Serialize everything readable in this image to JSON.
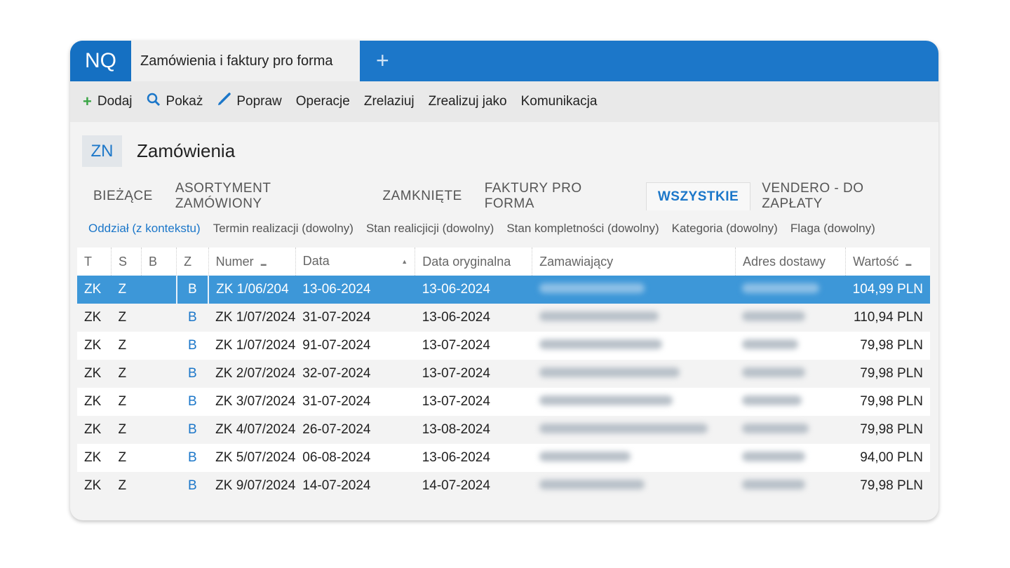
{
  "app": {
    "logo": "NQ",
    "tab_title": "Zamówienia i faktury pro forma",
    "new_tab": "+"
  },
  "toolbar": [
    {
      "label": "Dodaj",
      "icon": "plus-icon"
    },
    {
      "label": "Pokaż",
      "icon": "search-icon"
    },
    {
      "label": "Popraw",
      "icon": "brush-icon"
    },
    {
      "label": "Operacje"
    },
    {
      "label": "Zrelaziuj"
    },
    {
      "label": "Zrealizuj jako"
    },
    {
      "label": "Komunikacja"
    }
  ],
  "header": {
    "badge": "ZN",
    "title": "Zamówienia"
  },
  "tabs": [
    "BIEŻĄCE",
    "ASORTYMENT ZAMÓWIONY",
    "ZAMKNIĘTE",
    "FAKTURY PRO FORMA",
    "WSZYSTKIE",
    "VENDERO - DO ZAPŁATY"
  ],
  "active_tab": "WSZYSTKIE",
  "filters": [
    "Oddział (z kontekstu)",
    "Termin realizacji (dowolny)",
    "Stan realicjicji (dowolny)",
    "Stan kompletności (dowolny)",
    "Kategoria (dowolny)",
    "Flaga (dowolny)"
  ],
  "columns": [
    "T",
    "S",
    "B",
    "Z",
    "Numer",
    "Data",
    "Data oryginalna",
    "Zamawiający",
    "Adres dostawy",
    "Wartość"
  ],
  "rows": [
    {
      "t": "ZK",
      "s": "Z",
      "z": "B",
      "numer": "ZK 1/06/204",
      "data": "13-06-2024",
      "data_oryg": "13-06-2024",
      "wartosc": "104,99 PLN"
    },
    {
      "t": "ZK",
      "s": "Z",
      "z": "B",
      "numer": "ZK 1/07/2024",
      "data": "31-07-2024",
      "data_oryg": "13-06-2024",
      "wartosc": "110,94 PLN"
    },
    {
      "t": "ZK",
      "s": "Z",
      "z": "B",
      "numer": "ZK 1/07/2024",
      "data": "91-07-2024",
      "data_oryg": "13-07-2024",
      "wartosc": "79,98 PLN"
    },
    {
      "t": "ZK",
      "s": "Z",
      "z": "B",
      "numer": "ZK 2/07/2024",
      "data": "32-07-2024",
      "data_oryg": "13-07-2024",
      "wartosc": "79,98 PLN"
    },
    {
      "t": "ZK",
      "s": "Z",
      "z": "B",
      "numer": "ZK 3/07/2024",
      "data": "31-07-2024",
      "data_oryg": "13-07-2024",
      "wartosc": "79,98 PLN"
    },
    {
      "t": "ZK",
      "s": "Z",
      "z": "B",
      "numer": "ZK 4/07/2024",
      "data": "26-07-2024",
      "data_oryg": "13-08-2024",
      "wartosc": "79,98 PLN"
    },
    {
      "t": "ZK",
      "s": "Z",
      "z": "B",
      "numer": "ZK 5/07/2024",
      "data": "06-08-2024",
      "data_oryg": "13-06-2024",
      "wartosc": "94,00 PLN"
    },
    {
      "t": "ZK",
      "s": "Z",
      "z": "B",
      "numer": "ZK 9/07/2024",
      "data": "14-07-2024",
      "data_oryg": "14-07-2024",
      "wartosc": "79,98 PLN"
    }
  ]
}
